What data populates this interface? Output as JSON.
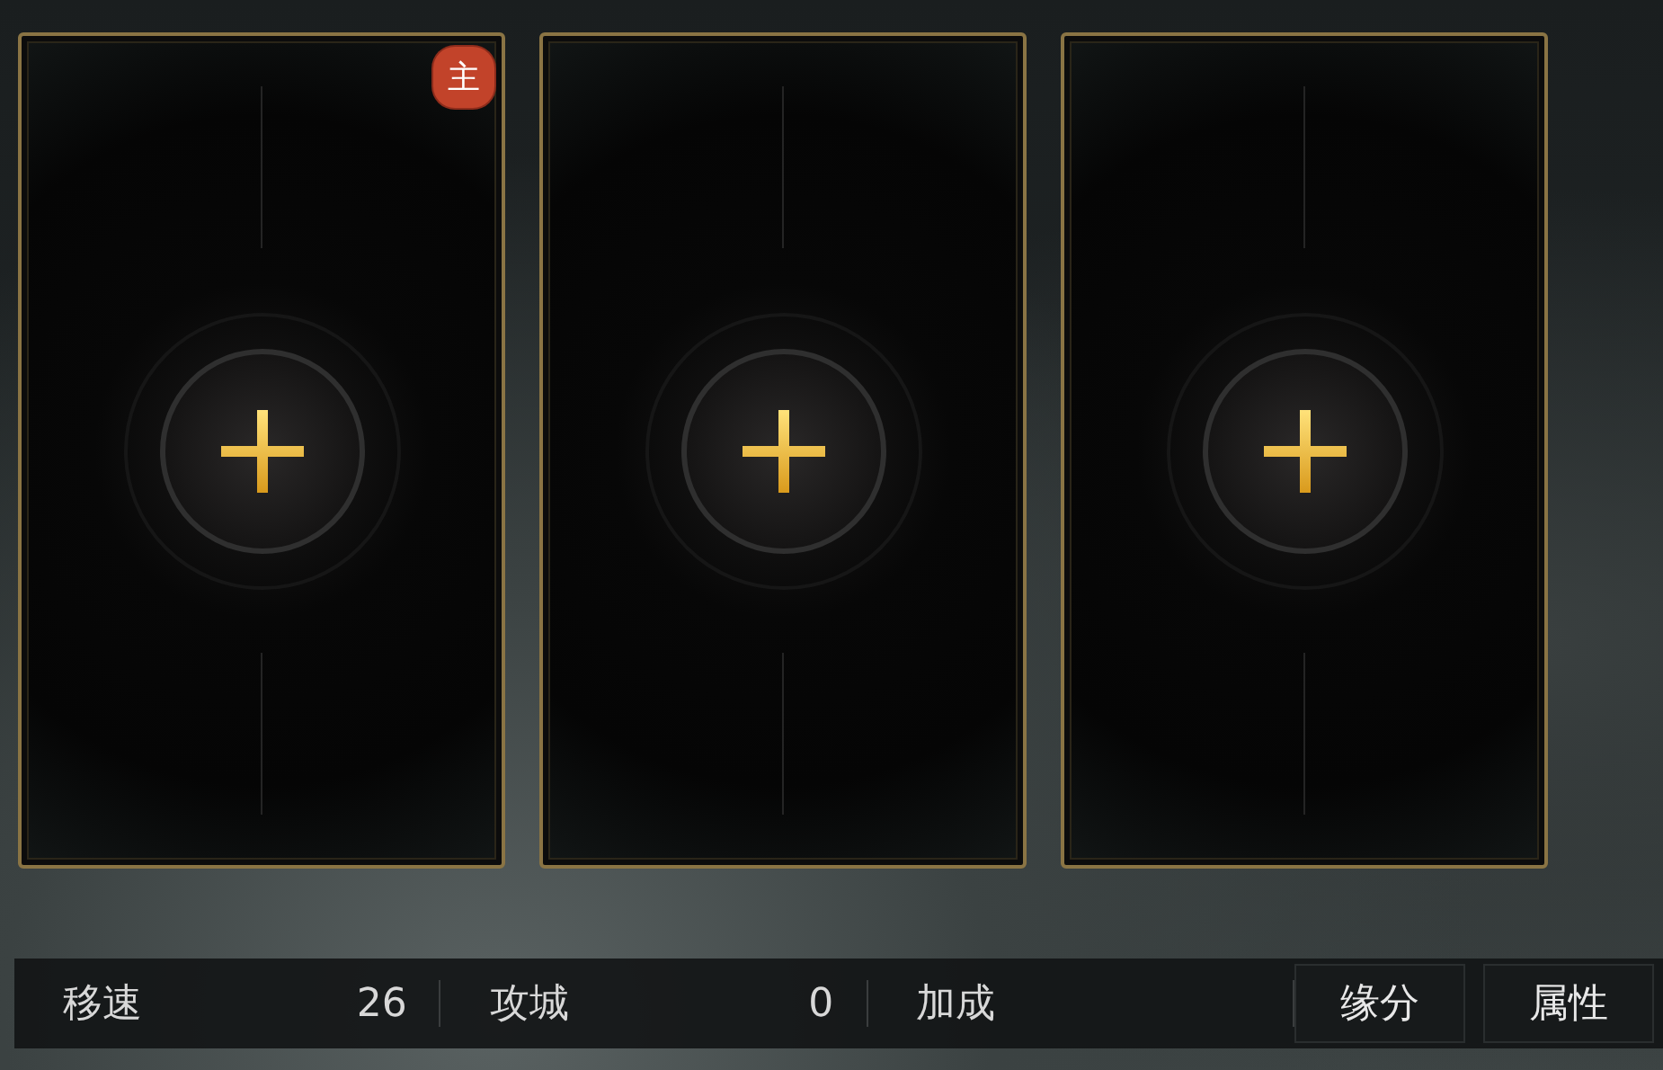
{
  "slots": [
    {
      "kind": "empty",
      "badge": "主"
    },
    {
      "kind": "empty"
    },
    {
      "kind": "empty"
    }
  ],
  "stats": [
    {
      "label": "移速",
      "value": "26"
    },
    {
      "label": "攻城",
      "value": "0"
    },
    {
      "label": "加成"
    }
  ],
  "buttons": [
    "缘分",
    "属性"
  ]
}
